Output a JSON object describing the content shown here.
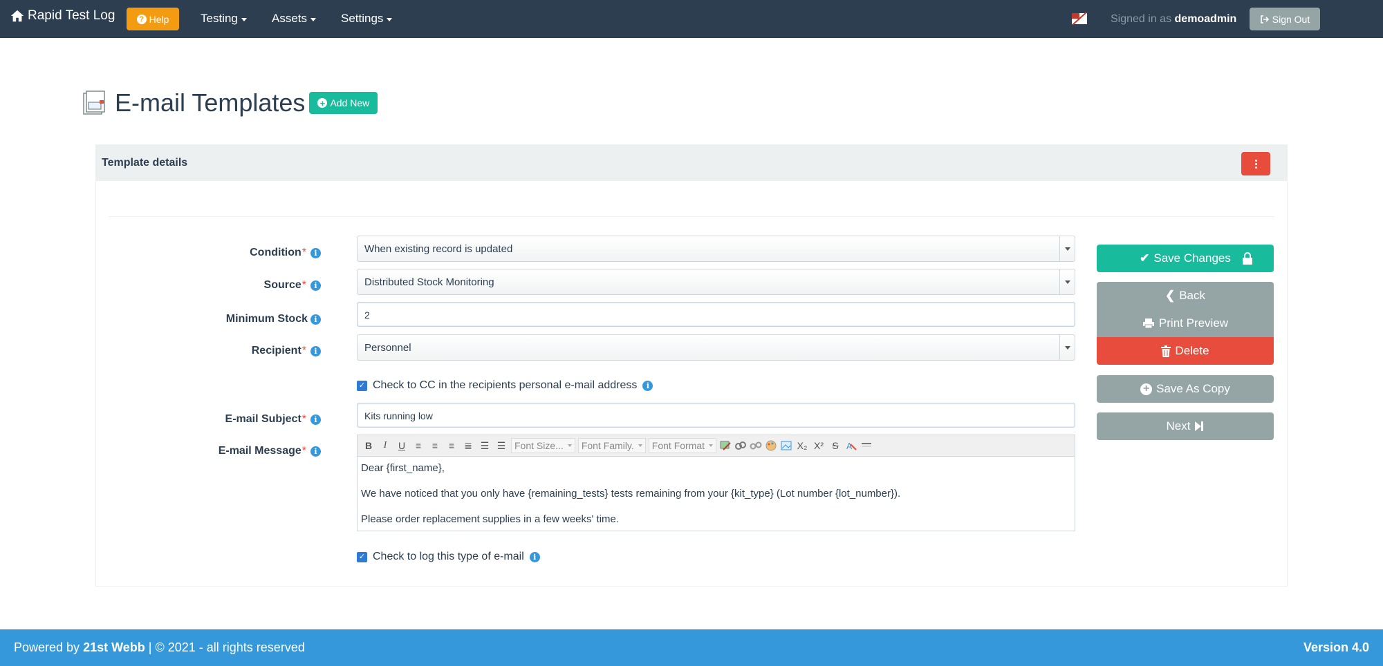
{
  "navbar": {
    "brand": "Rapid Test Log",
    "help_label": "Help",
    "menu": [
      {
        "label": "Testing"
      },
      {
        "label": "Assets"
      },
      {
        "label": "Settings"
      }
    ],
    "signed_in_prefix": "Signed in as",
    "username": "demoadmin",
    "signout_label": "Sign Out"
  },
  "page": {
    "title": "E-mail Templates",
    "add_new_label": "Add New"
  },
  "panel": {
    "title": "Template details"
  },
  "form": {
    "condition": {
      "label": "Condition",
      "value": "When existing record is updated"
    },
    "source": {
      "label": "Source",
      "value": "Distributed Stock Monitoring"
    },
    "minimum_stock": {
      "label": "Minimum Stock",
      "value": "2"
    },
    "recipient": {
      "label": "Recipient",
      "value": "Personnel"
    },
    "cc_checkbox": {
      "label": "Check to CC in the recipients personal e-mail address",
      "checked": true
    },
    "subject": {
      "label": "E-mail Subject",
      "value": "Kits running low"
    },
    "message": {
      "label": "E-mail Message",
      "toolbar": {
        "font_size": "Font Size...",
        "font_family": "Font Family.",
        "font_format": "Font Format"
      },
      "lines": [
        "Dear {first_name},",
        "We have noticed that you only have {remaining_tests} tests remaining from your {kit_type} (Lot number {lot_number}).",
        "Please order replacement supplies in a few weeks' time."
      ]
    },
    "log_checkbox": {
      "label": "Check to log this type of e-mail",
      "checked": true
    }
  },
  "actions": {
    "save": "Save Changes",
    "back": "Back",
    "print": "Print Preview",
    "delete": "Delete",
    "copy": "Save As Copy",
    "next": "Next"
  },
  "footer": {
    "powered_prefix": "Powered by",
    "company": "21st Webb",
    "copyright": "| © 2021 - all rights reserved",
    "version": "Version 4.0"
  },
  "colors": {
    "navbar": "#2c3e50",
    "help": "#f39c12",
    "success": "#18bc9c",
    "danger": "#e74c3c",
    "default": "#95a5a6",
    "footer": "#3498db"
  }
}
